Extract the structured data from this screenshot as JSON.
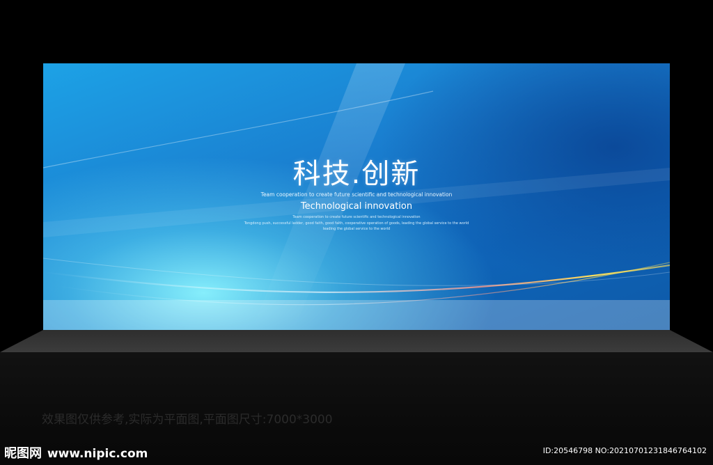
{
  "board": {
    "title": "科技.创新",
    "subtitle": "Team cooperation to create future scientific and technological innovation",
    "english_title": "Technological innovation",
    "small_lines": [
      "Team cooperation to create future scientific and technological innovation",
      "Tongdong push, successful ladder, good faith, good faith, cooperative operation of goods, leading the global service to the world",
      "leading the global service to the world"
    ]
  },
  "caption": "效果图仅供参考,实际为平面图,平面图尺寸:7000*3000",
  "watermark": {
    "logo_mark": "昵图网",
    "site": "www.nipic.com",
    "id_line": "ID:20546798 NO:20210701231846764102"
  },
  "colors": {
    "board_top": "#1da2e6",
    "board_bottom_left": "#8cf5ff",
    "stage": "#3c3c3c",
    "background": "#000000"
  }
}
